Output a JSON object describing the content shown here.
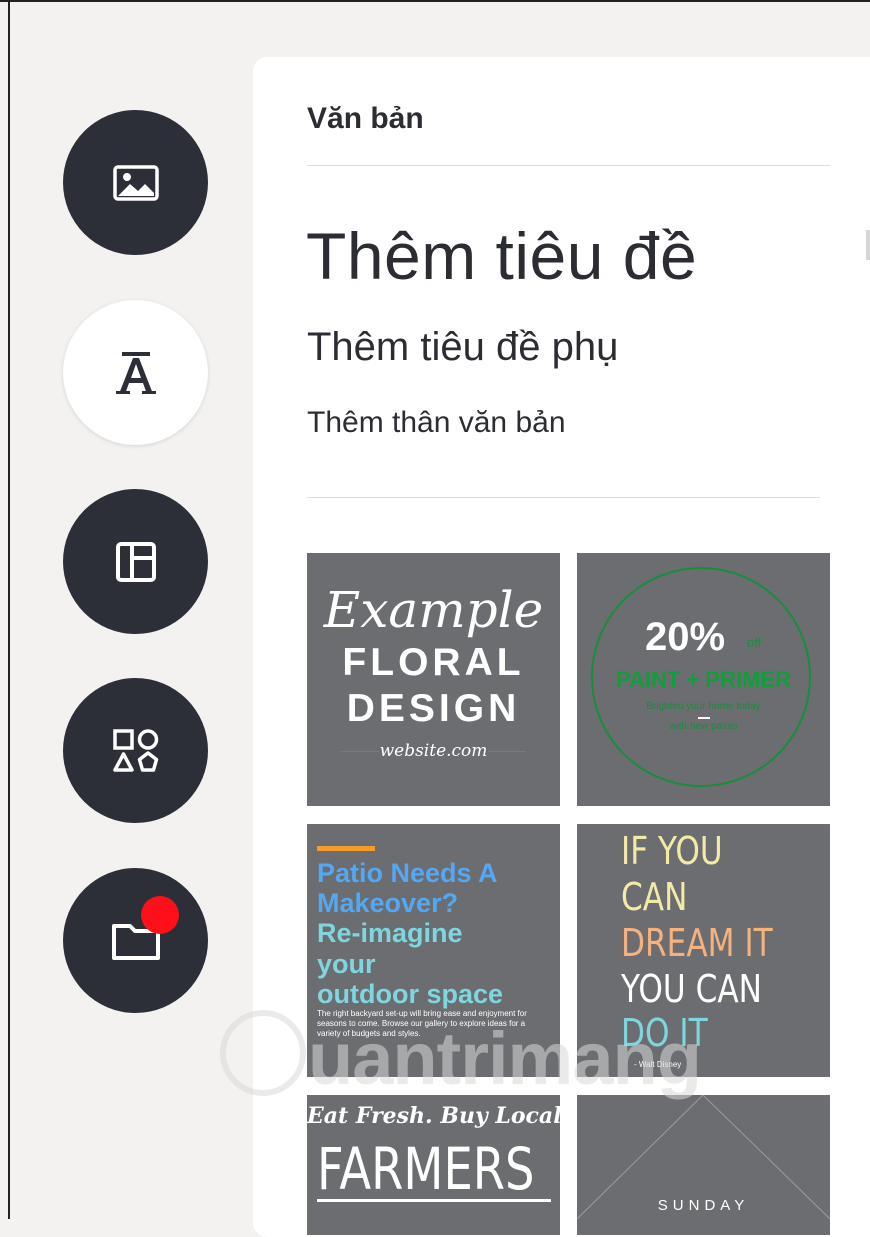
{
  "sidebar": {
    "items": [
      {
        "name": "photos",
        "icon": "image-icon",
        "active": false
      },
      {
        "name": "text",
        "icon": "text-icon",
        "active": true
      },
      {
        "name": "templates",
        "icon": "layout-icon",
        "active": false
      },
      {
        "name": "elements",
        "icon": "shapes-icon",
        "active": false
      },
      {
        "name": "uploads",
        "icon": "folder-icon",
        "active": false,
        "notification": true
      }
    ]
  },
  "panel": {
    "title": "Văn bản",
    "add_heading": "Thêm tiêu đề",
    "add_subheading": "Thêm tiêu đề phụ",
    "add_body": "Thêm thân văn bản"
  },
  "templates": {
    "t1": {
      "script": "Example",
      "line1": "FLORAL",
      "line2": "DESIGN",
      "website": "website.com"
    },
    "t2": {
      "percent": "20%",
      "off": "off",
      "paint": "PAINT + PRIMER",
      "small1": "Brighten your home today",
      "small2": "with new paints"
    },
    "t3": {
      "line1": "Patio Needs A",
      "line2": "Makeover?",
      "line3": "Re-imagine",
      "line4": "your",
      "line5": "outdoor space",
      "small": "The right backyard set-up will bring ease and enjoyment for seasons to come. Browse our gallery to explore ideas for a variety of budgets and styles."
    },
    "t4": {
      "line1": "IF YOU",
      "line2": "CAN",
      "line3": "DREAM IT",
      "line4": "YOU CAN",
      "line5": "DO IT",
      "credit": "- Walt Disney"
    },
    "t5": {
      "top": "Eat Fresh. Buy Local.",
      "big": "FARMERS"
    },
    "t6": {
      "text": "SUNDAY"
    }
  },
  "watermark": {
    "text": "uantrimang"
  },
  "colors": {
    "rail_dark": "#2d2f38",
    "badge": "#ff0f19",
    "tile_bg": "#6b6d71",
    "green": "#129d3b",
    "blue": "#54a7f2",
    "teal": "#7fd6df",
    "cream": "#f4eaa8",
    "peach": "#f6b27c",
    "orange": "#f39c2c"
  }
}
